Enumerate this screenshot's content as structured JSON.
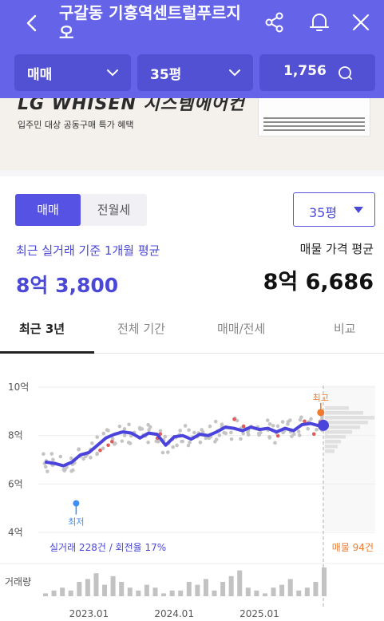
{
  "header": {
    "title": "구갈동 기흥역센트럴푸르지오",
    "icons": [
      "back-icon",
      "share-icon",
      "bell-icon",
      "close-icon"
    ],
    "background": "#6563e8"
  },
  "filters": {
    "deal_type": "매매",
    "size": "35평",
    "count": "1,756"
  },
  "banner": {
    "headline": "LG WHISEN 시스템에어컨",
    "subtitle": "입주민 대상 공동구매 특가 혜택"
  },
  "toggle": {
    "selected": "매매",
    "other": "전월세"
  },
  "size_select": {
    "value": "35평"
  },
  "summary": {
    "left_caption": "최근 실거래 기준 1개월 평균",
    "left_value": "8억 3,800",
    "right_caption": "매물 가격 평균",
    "right_value": "8억 6,686"
  },
  "period_tabs": [
    {
      "label": "최근 3년",
      "active": true
    },
    {
      "label": "전체 기간",
      "active": false
    },
    {
      "label": "매매/전세",
      "active": false
    },
    {
      "label": "비교",
      "active": false
    }
  ],
  "chart_labels": {
    "high": "최고",
    "low": "최저",
    "trades_summary": "실거래 228건 / 회전율 17%",
    "listings_summary": "매물 94건",
    "volume_label": "거래량"
  },
  "chart_data": {
    "type": "line",
    "y_ticks": [
      "10억",
      "8억",
      "6억",
      "4억"
    ],
    "x_ticks": [
      "2023.01",
      "2024.01",
      "2025.01"
    ],
    "ylim": [
      4,
      10
    ],
    "xlim": [
      2022.5,
      2025.9
    ],
    "avg_line_color": "#4a44dc",
    "series": [
      {
        "x": [
          2022.5,
          2022.6,
          2022.7,
          2022.8,
          2022.9,
          2023.0,
          2023.1,
          2023.2,
          2023.3,
          2023.4,
          2023.5,
          2023.6,
          2023.7,
          2023.8,
          2023.9,
          2024.0,
          2024.1,
          2024.2,
          2024.3,
          2024.4,
          2024.5,
          2024.6,
          2024.7,
          2024.8,
          2024.9,
          2025.0,
          2025.1,
          2025.2,
          2025.3,
          2025.4,
          2025.5,
          2025.6,
          2025.7,
          2025.75
        ],
        "y": [
          6.9,
          6.85,
          6.75,
          6.9,
          7.2,
          7.3,
          7.6,
          7.9,
          8.05,
          8.15,
          8.1,
          7.9,
          8.1,
          8.05,
          7.6,
          7.95,
          8.0,
          7.85,
          8.05,
          8.0,
          8.15,
          8.35,
          8.3,
          8.2,
          8.35,
          8.25,
          8.3,
          8.15,
          8.3,
          8.2,
          8.45,
          8.5,
          8.4,
          8.42
        ]
      }
    ],
    "high_point": {
      "x": 2025.72,
      "y": 8.95
    },
    "low_point": {
      "x": 2022.85,
      "y": 5.2
    },
    "volume_bars": [
      1,
      2,
      3,
      2,
      5,
      6,
      8,
      4,
      7,
      5,
      3,
      2,
      4,
      3,
      1,
      2,
      2,
      5,
      4,
      6,
      2,
      5,
      7,
      9,
      3,
      2,
      1,
      3,
      4,
      6,
      2,
      3,
      5,
      10
    ]
  }
}
